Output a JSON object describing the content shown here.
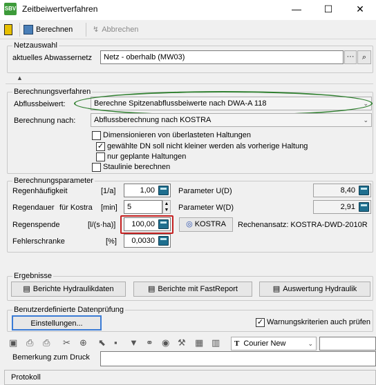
{
  "window": {
    "title": "Zeitbeiwertverfahren",
    "icon_text": "SBV",
    "minimize": "—",
    "maximize": "☐",
    "close": "✕"
  },
  "toolbar": {
    "calculate_label": "Berechnen",
    "cancel_label": "Abbrechen"
  },
  "network": {
    "group_title": "Netzauswahl",
    "label": "aktuelles Abwassernetz",
    "value": "Netz - oberhalb (MW03)",
    "browse_label": "···",
    "collapse_label": "▲"
  },
  "calc_method": {
    "group_title": "Berechnungsverfahren",
    "runoff_label": "Abflussbeiwert:",
    "runoff_value": "Berechne Spitzenabflussbeiwerte nach DWA-A 118",
    "calc_by_label": "Berechnung nach:",
    "calc_by_value": "Abflussberechnung nach KOSTRA",
    "checkboxes": [
      {
        "label": "Dimensionieren von überlasteten Haltungen",
        "checked": false
      },
      {
        "label": "gewählte DN soll nicht kleiner werden als vorherige Haltung",
        "checked": true
      },
      {
        "label": "nur geplante Haltungen",
        "checked": false
      },
      {
        "label": "Staulinie berechnen",
        "checked": false
      }
    ]
  },
  "params": {
    "group_title": "Berechnungsparameter",
    "rain_freq_label": "Regenhäufigkeit",
    "rain_freq_unit": "[1/a]",
    "rain_freq_value": "1,00",
    "rain_dur_label": "Regendauer",
    "rain_dur_sub": "für Kostra",
    "rain_dur_unit": "[min]",
    "rain_dur_value": "5",
    "rain_yield_label": "Regenspende",
    "rain_yield_unit": "[l/(s·ha)]",
    "rain_yield_value": "100,00",
    "error_label": "Fehlerschranke",
    "error_unit": "[%]",
    "error_value": "0,0030",
    "param_u_label": "Parameter U(D)",
    "param_u_value": "8,40",
    "param_w_label": "Parameter W(D)",
    "param_w_value": "2,91",
    "kostra_label": "KOSTRA",
    "rechenansatz": "Rechenansatz: KOSTRA-DWD-2010R"
  },
  "results": {
    "group_title": "Ergebnisse",
    "btn_hydraulic": "Berichte Hydraulikdaten",
    "btn_fastreport": "Berichte mit FastReport",
    "btn_eval": "Auswertung Hydraulik"
  },
  "validation": {
    "group_title": "Benutzerdefinierte Datenprüfung",
    "settings_label": "Einstellungen...",
    "warning_label": "Warnungskriterien auch prüfen",
    "warning_checked": true
  },
  "editor": {
    "font_value": "Courier New",
    "remark_label": "Bemerkung zum Druck",
    "protocol_label": "Protokoll"
  },
  "colors": {
    "highlight_ellipse": "#2f7f2f",
    "highlight_box": "#c42020"
  }
}
